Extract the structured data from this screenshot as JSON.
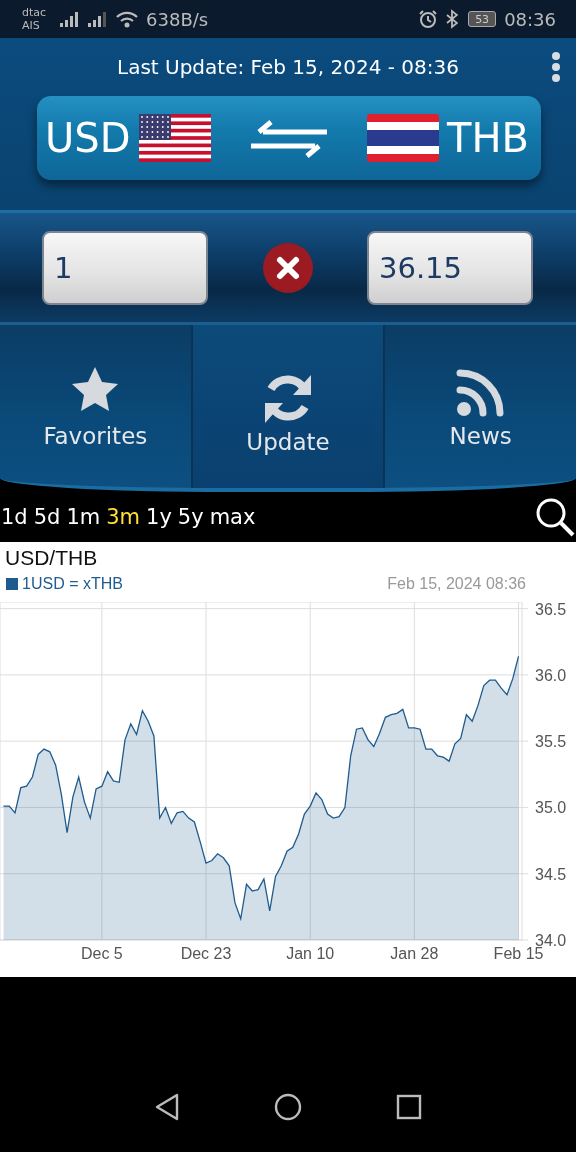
{
  "status_bar": {
    "carrier_lines": [
      "dtac",
      "AIS"
    ],
    "net_speed": "638B/s",
    "battery": "53",
    "time": "08:36"
  },
  "header": {
    "last_update": "Last Update: Feb 15, 2024 - 08:36"
  },
  "converter": {
    "from_code": "USD",
    "to_code": "THB",
    "amount": "1",
    "result": "36.15"
  },
  "actions": [
    {
      "label": "Favorites",
      "kind": "star"
    },
    {
      "label": "Update",
      "kind": "refresh"
    },
    {
      "label": "News",
      "kind": "feed"
    }
  ],
  "ranges": [
    {
      "label": "1d",
      "selected": false
    },
    {
      "label": "5d",
      "selected": false
    },
    {
      "label": "1m",
      "selected": false
    },
    {
      "label": "3m",
      "selected": true
    },
    {
      "label": "1y",
      "selected": false
    },
    {
      "label": "5y",
      "selected": false
    },
    {
      "label": "max",
      "selected": false
    }
  ],
  "chart": {
    "timestamp": "Feb 15, 2024 08:36",
    "chart_data": {
      "type": "area",
      "title": "USD/THB",
      "categories": [
        null,
        null,
        null,
        null,
        null,
        null,
        null,
        null,
        null,
        null,
        null,
        null,
        null,
        null,
        null,
        null,
        null,
        "Dec 5",
        null,
        null,
        null,
        null,
        null,
        null,
        null,
        null,
        null,
        null,
        null,
        null,
        null,
        null,
        null,
        null,
        null,
        "Dec 23",
        null,
        null,
        null,
        null,
        null,
        null,
        null,
        null,
        null,
        null,
        null,
        null,
        null,
        null,
        null,
        null,
        null,
        "Jan 10",
        null,
        null,
        null,
        null,
        null,
        null,
        null,
        null,
        null,
        null,
        null,
        null,
        null,
        null,
        null,
        null,
        null,
        "Jan 28",
        null,
        null,
        null,
        null,
        null,
        null,
        null,
        null,
        null,
        null,
        null,
        null,
        null,
        null,
        null,
        null,
        null,
        "Feb 15"
      ],
      "series": [
        {
          "name": "1USD = xTHB",
          "color": "#1f5b8e",
          "values": [
            35.01,
            35.01,
            34.96,
            35.15,
            35.16,
            35.23,
            35.4,
            35.44,
            35.42,
            35.32,
            35.1,
            34.81,
            35.08,
            35.23,
            35.04,
            34.92,
            35.14,
            35.16,
            35.27,
            35.2,
            35.19,
            35.51,
            35.63,
            35.55,
            35.73,
            35.65,
            35.54,
            34.92,
            35,
            34.88,
            34.96,
            34.97,
            34.92,
            34.89,
            34.74,
            34.58,
            34.6,
            34.65,
            34.62,
            34.56,
            34.28,
            34.16,
            34.42,
            34.37,
            34.38,
            34.46,
            34.22,
            34.48,
            34.56,
            34.67,
            34.7,
            34.8,
            34.95,
            35.01,
            35.11,
            35.06,
            34.95,
            34.92,
            34.93,
            35,
            35.39,
            35.59,
            35.6,
            35.51,
            35.46,
            35.56,
            35.68,
            35.7,
            35.71,
            35.74,
            35.6,
            35.6,
            35.59,
            35.44,
            35.44,
            35.39,
            35.38,
            35.35,
            35.48,
            35.52,
            35.7,
            35.65,
            35.77,
            35.92,
            35.96,
            35.96,
            35.9,
            35.85,
            35.97,
            36.14
          ]
        }
      ],
      "grid": true,
      "ylim": [
        34,
        36.55
      ],
      "yticks": [
        {
          "value": 34,
          "label": "34.0"
        },
        {
          "value": 34.5,
          "label": "34.5"
        },
        {
          "value": 35,
          "label": "35.0"
        },
        {
          "value": 35.5,
          "label": "35.5"
        },
        {
          "value": 36,
          "label": "36.0"
        },
        {
          "value": 36.5,
          "label": "36.5"
        }
      ]
    }
  }
}
